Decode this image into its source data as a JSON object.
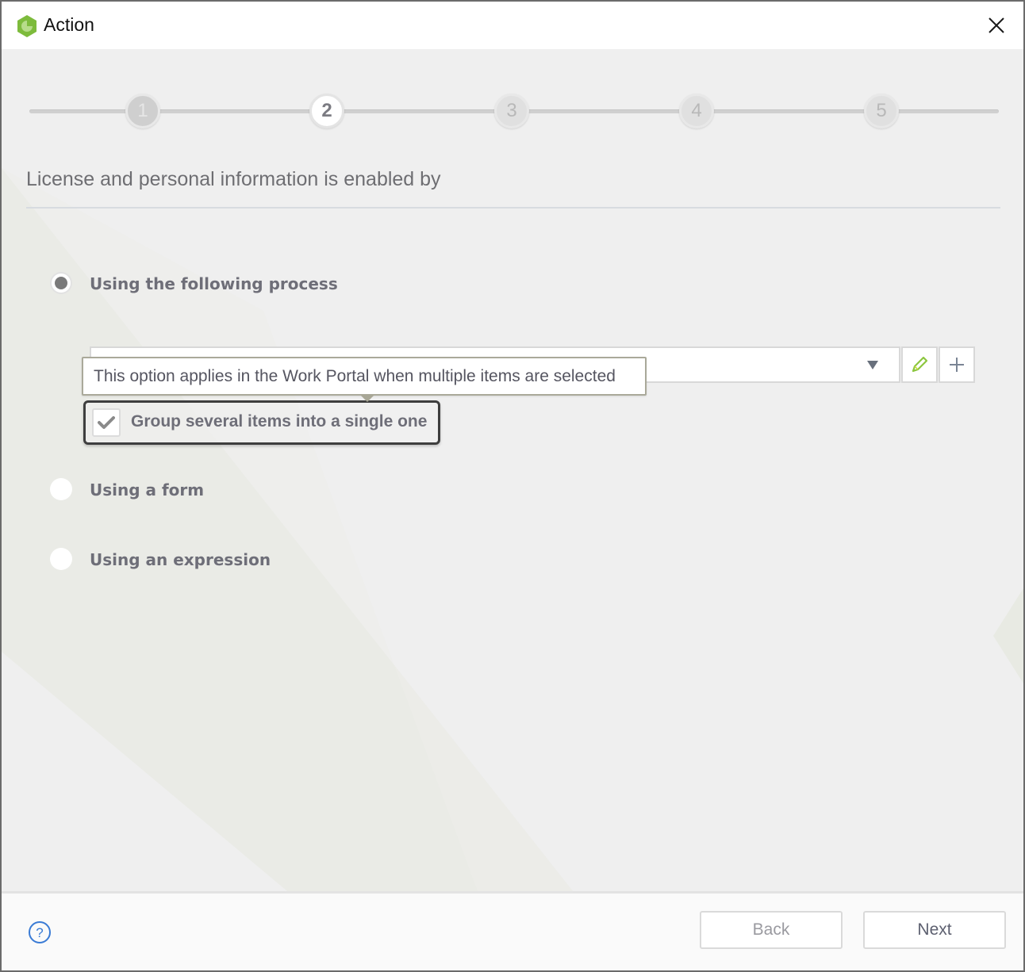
{
  "window": {
    "title": "Action",
    "close_label": "Close"
  },
  "stepper": {
    "current_step": 2,
    "total_steps": 5,
    "steps": [
      {
        "label": "1",
        "state": "done"
      },
      {
        "label": "2",
        "state": "active"
      },
      {
        "label": "3",
        "state": "pending"
      },
      {
        "label": "4",
        "state": "pending"
      },
      {
        "label": "5",
        "state": "pending"
      }
    ]
  },
  "main": {
    "heading": "License and personal information is enabled by",
    "options": [
      {
        "label": "Using the following process",
        "selected": true
      },
      {
        "label": "Using a form",
        "selected": false
      },
      {
        "label": "Using an expression",
        "selected": false
      }
    ],
    "process_select": {
      "value": "",
      "edit_icon": "pencil-icon",
      "add_icon": "plus-icon"
    },
    "tooltip": "This option applies in the Work Portal when multiple items are selected",
    "group_checkbox": {
      "label": "Group several items into a single one",
      "checked": true
    }
  },
  "footer": {
    "help_icon": "help-circle-icon",
    "back_label": "Back",
    "next_label": "Next"
  },
  "colors": {
    "brand_green": "#7dbb3c",
    "accent_pencil": "#8cc63f",
    "help_blue": "#3a7bd5"
  }
}
